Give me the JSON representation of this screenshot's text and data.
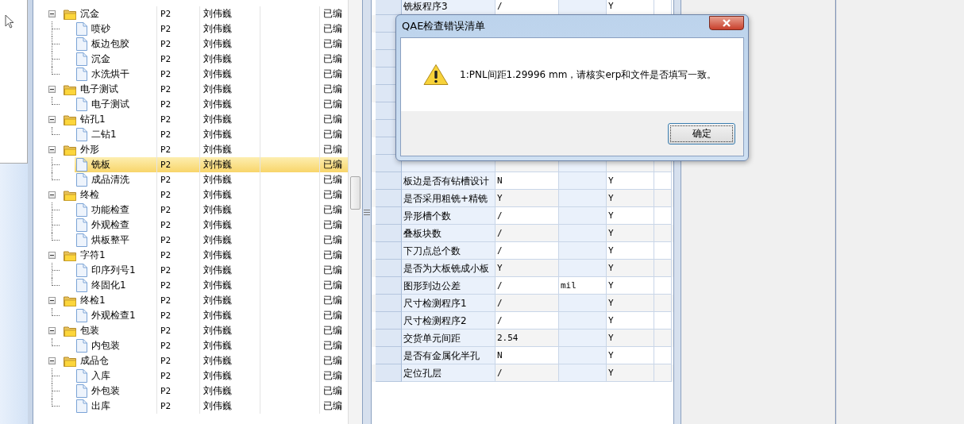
{
  "tree": [
    {
      "label": "沉金",
      "kind": "folder",
      "expanded": true,
      "selected": false,
      "level": "P2",
      "owner": "刘伟巍",
      "status": "已编",
      "children": [
        {
          "label": "喷砂",
          "kind": "file",
          "selected": false,
          "level": "P2",
          "owner": "刘伟巍",
          "status": "已编"
        },
        {
          "label": "板边包胶",
          "kind": "file",
          "selected": false,
          "level": "P2",
          "owner": "刘伟巍",
          "status": "已编"
        },
        {
          "label": "沉金",
          "kind": "file",
          "selected": false,
          "level": "P2",
          "owner": "刘伟巍",
          "status": "已编"
        },
        {
          "label": "水洗烘干",
          "kind": "file",
          "selected": false,
          "level": "P2",
          "owner": "刘伟巍",
          "status": "已编"
        }
      ]
    },
    {
      "label": "电子测试",
      "kind": "folder",
      "expanded": true,
      "selected": false,
      "level": "P2",
      "owner": "刘伟巍",
      "status": "已编",
      "children": [
        {
          "label": "电子测试",
          "kind": "file",
          "selected": false,
          "level": "P2",
          "owner": "刘伟巍",
          "status": "已编"
        }
      ]
    },
    {
      "label": "钻孔1",
      "kind": "folder",
      "expanded": true,
      "selected": false,
      "level": "P2",
      "owner": "刘伟巍",
      "status": "已编",
      "children": [
        {
          "label": "二钻1",
          "kind": "file",
          "selected": false,
          "level": "P2",
          "owner": "刘伟巍",
          "status": "已编"
        }
      ]
    },
    {
      "label": "外形",
      "kind": "folder",
      "expanded": true,
      "selected": false,
      "level": "P2",
      "owner": "刘伟巍",
      "status": "已编",
      "children": [
        {
          "label": "铣板",
          "kind": "file",
          "selected": true,
          "level": "P2",
          "owner": "刘伟巍",
          "status": "已编"
        },
        {
          "label": "成品清洗",
          "kind": "file",
          "selected": false,
          "level": "P2",
          "owner": "刘伟巍",
          "status": "已编"
        }
      ]
    },
    {
      "label": "终检",
      "kind": "folder",
      "expanded": true,
      "selected": false,
      "level": "P2",
      "owner": "刘伟巍",
      "status": "已编",
      "children": [
        {
          "label": "功能检查",
          "kind": "file",
          "selected": false,
          "level": "P2",
          "owner": "刘伟巍",
          "status": "已编"
        },
        {
          "label": "外观检查",
          "kind": "file",
          "selected": false,
          "level": "P2",
          "owner": "刘伟巍",
          "status": "已编"
        },
        {
          "label": "烘板整平",
          "kind": "file",
          "selected": false,
          "level": "P2",
          "owner": "刘伟巍",
          "status": "已编"
        }
      ]
    },
    {
      "label": "字符1",
      "kind": "folder",
      "expanded": true,
      "selected": false,
      "level": "P2",
      "owner": "刘伟巍",
      "status": "已编",
      "children": [
        {
          "label": "印序列号1",
          "kind": "file",
          "selected": false,
          "level": "P2",
          "owner": "刘伟巍",
          "status": "已编"
        },
        {
          "label": "终固化1",
          "kind": "file",
          "selected": false,
          "level": "P2",
          "owner": "刘伟巍",
          "status": "已编"
        }
      ]
    },
    {
      "label": "终检1",
      "kind": "folder",
      "expanded": true,
      "selected": false,
      "level": "P2",
      "owner": "刘伟巍",
      "status": "已编",
      "children": [
        {
          "label": "外观检查1",
          "kind": "file",
          "selected": false,
          "level": "P2",
          "owner": "刘伟巍",
          "status": "已编"
        }
      ]
    },
    {
      "label": "包装",
      "kind": "folder",
      "expanded": true,
      "selected": false,
      "level": "P2",
      "owner": "刘伟巍",
      "status": "已编",
      "children": [
        {
          "label": "内包装",
          "kind": "file",
          "selected": false,
          "level": "P2",
          "owner": "刘伟巍",
          "status": "已编"
        }
      ]
    },
    {
      "label": "成品仓",
      "kind": "folder",
      "expanded": true,
      "selected": false,
      "level": "P2",
      "owner": "刘伟巍",
      "status": "已编",
      "children": [
        {
          "label": "入库",
          "kind": "file",
          "selected": false,
          "level": "P2",
          "owner": "刘伟巍",
          "status": "已编"
        },
        {
          "label": "外包装",
          "kind": "file",
          "selected": false,
          "level": "P2",
          "owner": "刘伟巍",
          "status": "已编"
        },
        {
          "label": "出库",
          "kind": "file",
          "selected": false,
          "level": "P2",
          "owner": "刘伟巍",
          "status": "已编"
        }
      ]
    }
  ],
  "table_top": [
    {
      "name": "铣板程序3",
      "value": "/",
      "check": "Y"
    }
  ],
  "table": [
    {
      "name": "板边是否有钻槽设计",
      "value": "N",
      "check": "Y"
    },
    {
      "name": "是否采用粗铣+精铣",
      "value": "Y",
      "check": "Y"
    },
    {
      "name": "异形槽个数",
      "value": "/",
      "check": "Y"
    },
    {
      "name": "叠板块数",
      "value": "/",
      "check": "Y"
    },
    {
      "name": "下刀点总个数",
      "value": "/",
      "check": "Y"
    },
    {
      "name": "是否为大板铣成小板",
      "value": "Y",
      "check": "Y"
    },
    {
      "name": "图形到边公差",
      "value": "/",
      "unit": "mil",
      "check": "Y"
    },
    {
      "name": "尺寸检测程序1",
      "value": "/",
      "check": "Y"
    },
    {
      "name": "尺寸检测程序2",
      "value": "/",
      "check": "Y"
    },
    {
      "name": "交货单元间距",
      "value": "2.54",
      "check": "Y"
    },
    {
      "name": "是否有金属化半孔",
      "value": "N",
      "check": "Y"
    },
    {
      "name": "定位孔层",
      "value": "/",
      "check": "Y"
    }
  ],
  "dialog": {
    "title": "QAE检查错误清单",
    "message": "1:PNL间距1.29996 mm，请核实erp和文件是否填写一致。",
    "buttons": [
      "确定"
    ]
  }
}
